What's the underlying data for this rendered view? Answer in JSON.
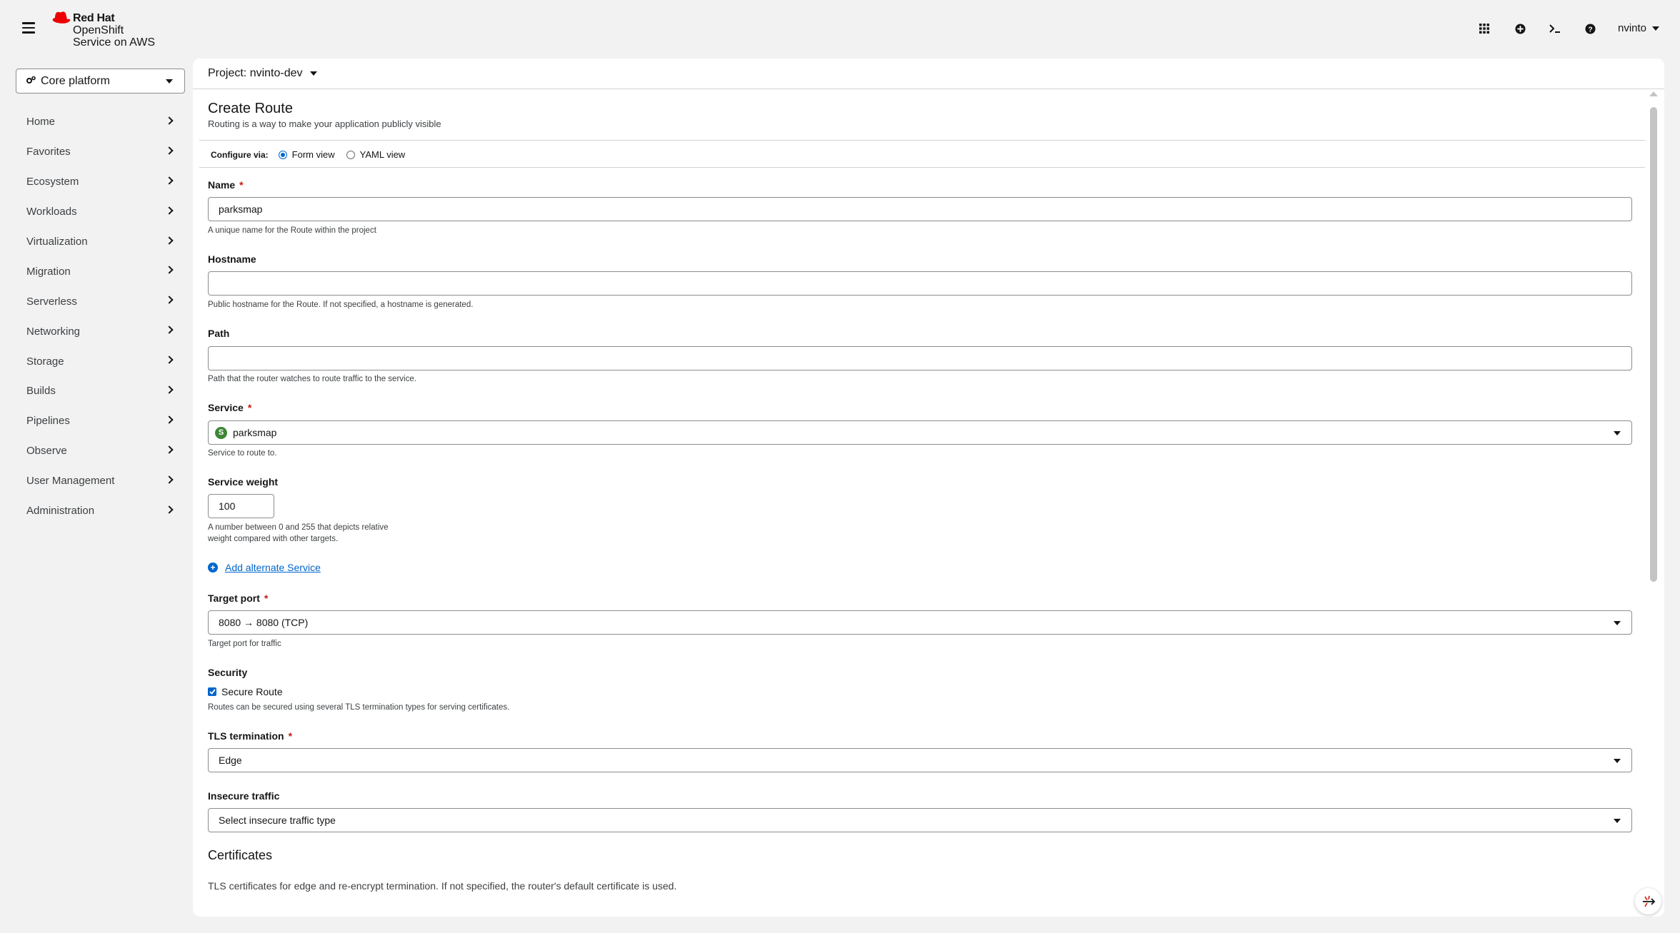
{
  "masthead": {
    "brand_line1": "Red Hat",
    "brand_line2": "OpenShift",
    "brand_line3": "Service on AWS",
    "icons": [
      "app-launcher-icon",
      "quick-create-icon",
      "terminal-icon",
      "help-icon"
    ],
    "user": "nvinto"
  },
  "sidebar": {
    "perspective": "Core platform",
    "items": [
      {
        "label": "Home"
      },
      {
        "label": "Favorites"
      },
      {
        "label": "Ecosystem"
      },
      {
        "label": "Workloads"
      },
      {
        "label": "Virtualization"
      },
      {
        "label": "Migration"
      },
      {
        "label": "Serverless"
      },
      {
        "label": "Networking"
      },
      {
        "label": "Storage"
      },
      {
        "label": "Builds"
      },
      {
        "label": "Pipelines"
      },
      {
        "label": "Observe"
      },
      {
        "label": "User Management"
      },
      {
        "label": "Administration"
      }
    ]
  },
  "project_bar": {
    "label": "Project: nvinto-dev"
  },
  "page": {
    "title": "Create Route",
    "subtitle": "Routing is a way to make your application publicly visible",
    "configure_label": "Configure via:",
    "form_view": "Form view",
    "yaml_view": "YAML view",
    "selected_view": "form"
  },
  "form": {
    "name": {
      "label": "Name",
      "required": "*",
      "value": "parksmap",
      "help": "A unique name for the Route within the project"
    },
    "hostname": {
      "label": "Hostname",
      "value": "",
      "help": "Public hostname for the Route. If not specified, a hostname is generated."
    },
    "path": {
      "label": "Path",
      "value": "",
      "help": "Path that the router watches to route traffic to the service."
    },
    "service": {
      "label": "Service",
      "required": "*",
      "badge": "S",
      "value": "parksmap",
      "help": "Service to route to."
    },
    "service_weight": {
      "label": "Service weight",
      "value": "100",
      "help_line1": "A number between 0 and 255 that depicts relative",
      "help_line2": "weight compared with other targets."
    },
    "add_alternate": "Add alternate Service",
    "target_port": {
      "label": "Target port",
      "required": "*",
      "value": "8080 → 8080 (TCP)",
      "help": "Target port for traffic"
    },
    "security": {
      "label": "Security",
      "checkbox_label": "Secure Route",
      "checked": true,
      "help": "Routes can be secured using several TLS termination types for serving certificates."
    },
    "tls_termination": {
      "label": "TLS termination",
      "required": "*",
      "value": "Edge"
    },
    "insecure_traffic": {
      "label": "Insecure traffic",
      "placeholder": "Select insecure traffic type"
    },
    "certificates": {
      "title": "Certificates",
      "text": "TLS certificates for edge and re-encrypt termination. If not specified, the router's default certificate is used."
    }
  },
  "colors": {
    "accent": "#0066cc",
    "required": "#c9190b",
    "service_badge": "#3e8635",
    "redhat": "#ee0000"
  }
}
